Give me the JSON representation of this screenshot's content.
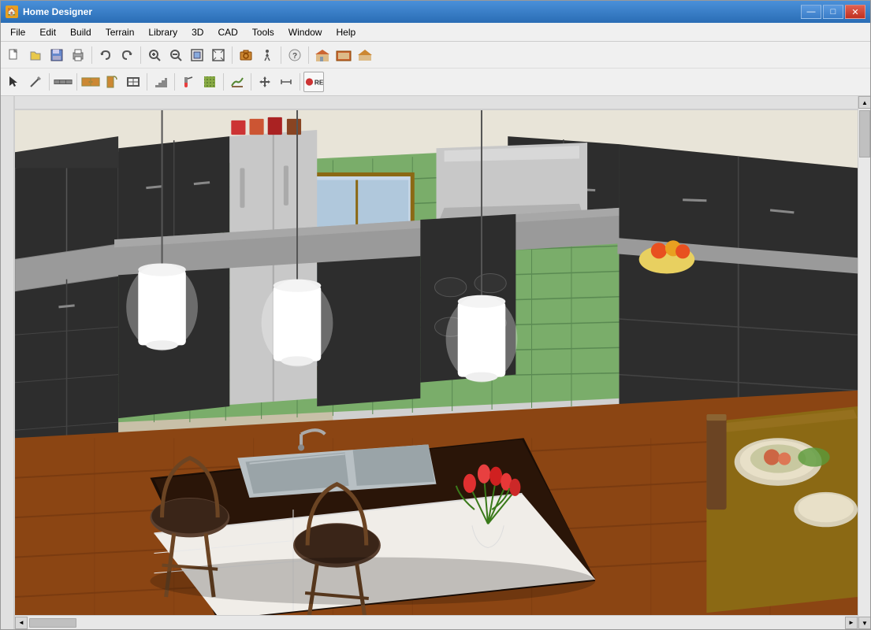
{
  "window": {
    "title": "Home Designer",
    "icon": "🏠"
  },
  "title_controls": {
    "minimize": "—",
    "maximize": "□",
    "close": "✕"
  },
  "menu": {
    "items": [
      "File",
      "Edit",
      "Build",
      "Terrain",
      "Library",
      "3D",
      "CAD",
      "Tools",
      "Window",
      "Help"
    ]
  },
  "toolbar1": {
    "buttons": [
      {
        "name": "new",
        "icon": "📄"
      },
      {
        "name": "open",
        "icon": "📂"
      },
      {
        "name": "save",
        "icon": "💾"
      },
      {
        "name": "print",
        "icon": "🖨"
      },
      {
        "name": "undo",
        "icon": "↩"
      },
      {
        "name": "redo",
        "icon": "↪"
      },
      {
        "name": "zoom-in",
        "icon": "🔍"
      },
      {
        "name": "zoom-out",
        "icon": "🔎"
      },
      {
        "name": "zoom-full",
        "icon": "⛶"
      },
      {
        "name": "zoom-fit",
        "icon": "⊞"
      },
      {
        "name": "camera",
        "icon": "📷"
      },
      {
        "name": "walk",
        "icon": "🚶"
      },
      {
        "name": "help",
        "icon": "?"
      },
      {
        "name": "house",
        "icon": "🏠"
      },
      {
        "name": "plan",
        "icon": "📋"
      },
      {
        "name": "elevation",
        "icon": "📐"
      }
    ]
  },
  "toolbar2": {
    "buttons": [
      {
        "name": "select",
        "icon": "↖"
      },
      {
        "name": "draw",
        "icon": "✏"
      },
      {
        "name": "room",
        "icon": "⬜"
      },
      {
        "name": "wall",
        "icon": "▤"
      },
      {
        "name": "door",
        "icon": "🚪"
      },
      {
        "name": "window",
        "icon": "⬛"
      },
      {
        "name": "stair",
        "icon": "▤"
      },
      {
        "name": "cabinet",
        "icon": "🗄"
      },
      {
        "name": "furniture",
        "icon": "🛋"
      },
      {
        "name": "paint",
        "icon": "🖌"
      },
      {
        "name": "terrain",
        "icon": "⛰"
      },
      {
        "name": "move",
        "icon": "✥"
      },
      {
        "name": "dimension",
        "icon": "↔"
      },
      {
        "name": "record",
        "icon": "⏺"
      }
    ]
  },
  "viewport": {
    "scene": "kitchen-3d-view"
  }
}
